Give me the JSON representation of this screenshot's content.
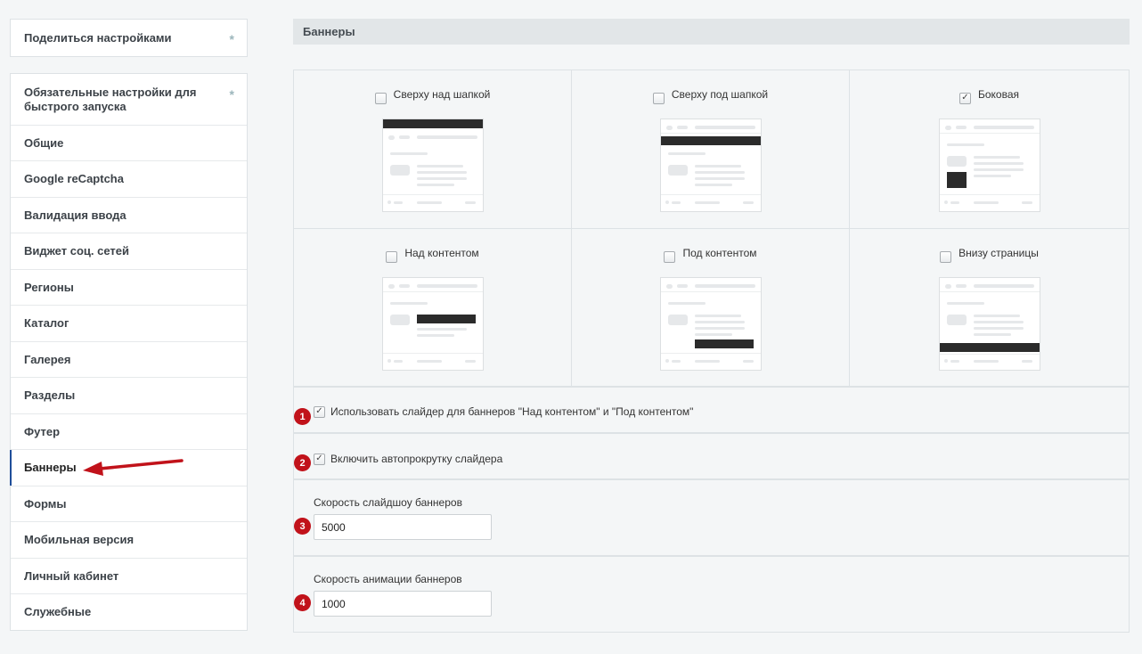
{
  "sidebar": {
    "share_label": "Поделиться настройками",
    "items": [
      {
        "label": "Обязательные настройки для быстрого запуска",
        "star": true
      },
      {
        "label": "Общие"
      },
      {
        "label": "Google reCaptcha"
      },
      {
        "label": "Валидация ввода"
      },
      {
        "label": "Виджет соц. сетей"
      },
      {
        "label": "Регионы"
      },
      {
        "label": "Каталог"
      },
      {
        "label": "Галерея"
      },
      {
        "label": "Разделы"
      },
      {
        "label": "Футер"
      },
      {
        "label": "Баннеры",
        "active": true
      },
      {
        "label": "Формы"
      },
      {
        "label": "Мобильная версия"
      },
      {
        "label": "Личный кабинет"
      },
      {
        "label": "Служебные"
      }
    ]
  },
  "main": {
    "title": "Баннеры",
    "positions": [
      {
        "label": "Сверху над шапкой",
        "checked": false
      },
      {
        "label": "Сверху под шапкой",
        "checked": false
      },
      {
        "label": "Боковая",
        "checked": true
      },
      {
        "label": "Над контентом",
        "checked": false
      },
      {
        "label": "Под контентом",
        "checked": false
      },
      {
        "label": "Внизу страницы",
        "checked": false
      }
    ],
    "use_slider_label": "Использовать слайдер для баннеров \"Над контентом\" и \"Под контентом\"",
    "use_slider_checked": true,
    "autoscroll_label": "Включить автопрокрутку слайдера",
    "autoscroll_checked": true,
    "slideshow_speed_label": "Скорость слайдшоу баннеров",
    "slideshow_speed_value": "5000",
    "animation_speed_label": "Скорость анимации баннеров",
    "animation_speed_value": "1000"
  },
  "annotations": {
    "badges": [
      "1",
      "2",
      "3",
      "4"
    ],
    "accent_color": "#c1121a"
  },
  "icons": {
    "star": "star-icon",
    "check": "✓"
  }
}
